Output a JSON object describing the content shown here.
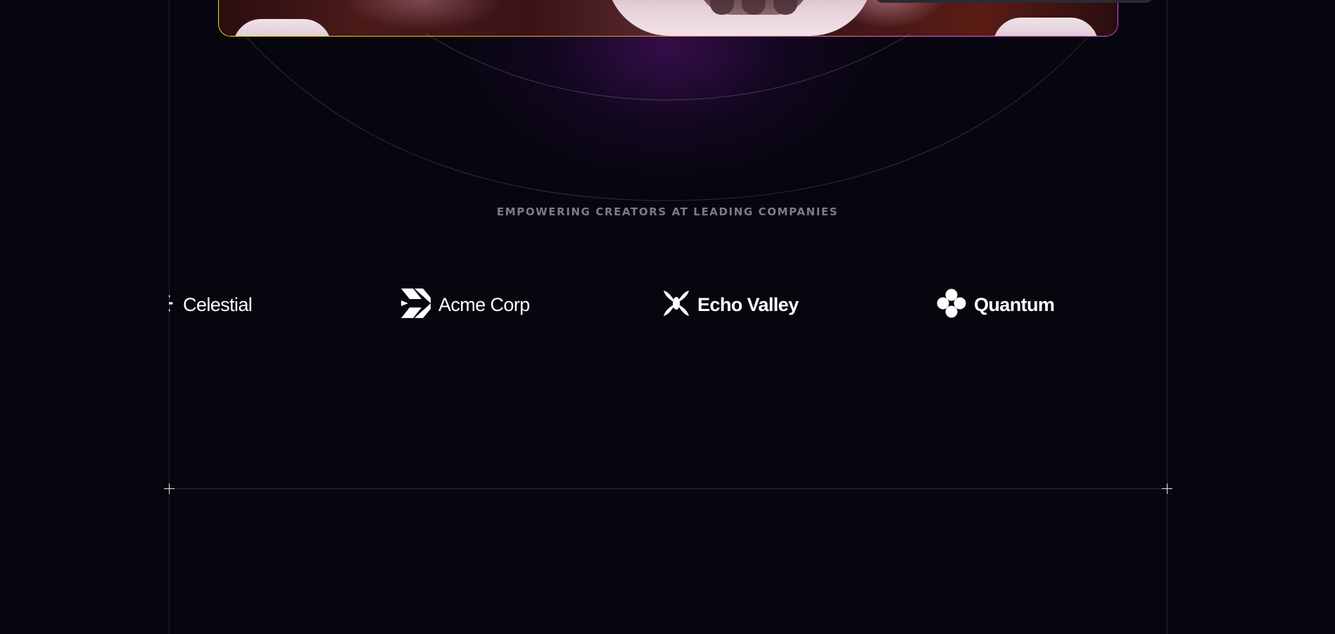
{
  "colors": {
    "background": "#07060f",
    "tagline": "#7c7a8c",
    "logo_text": "#ffffff",
    "frame_line": "#2a2934",
    "hero_border_start": "#f5e60a",
    "hero_border_end": "#d64bf0"
  },
  "hero": {
    "image_name": "robot-hero-image"
  },
  "section": {
    "tagline": "EMPOWERING CREATORS AT LEADING COMPANIES"
  },
  "logos": [
    {
      "name": "Celestial",
      "icon": "celestial-logo-icon"
    },
    {
      "name": "Acme Corp",
      "icon": "acme-corp-logo-icon"
    },
    {
      "name": "Echo Valley",
      "icon": "echo-valley-logo-icon"
    },
    {
      "name": "Quantum",
      "icon": "quantum-logo-icon"
    }
  ]
}
